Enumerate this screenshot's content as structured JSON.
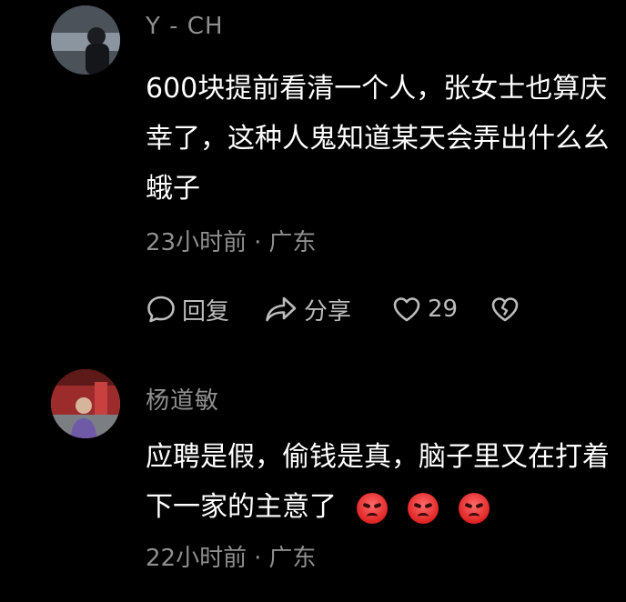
{
  "comments": [
    {
      "username": "Y - CH",
      "text": "600块提前看清一个人，张女士也算庆幸了，这种人鬼知道某天会弄出什么幺蛾子",
      "time": "23小时前",
      "location": "广东",
      "actions": {
        "reply_label": "回复",
        "share_label": "分享",
        "like_count": "29"
      }
    },
    {
      "username": "杨道敏",
      "text": "应聘是假，偷钱是真，脑子里又在打着下一家的主意了",
      "emojis": [
        "angry-face-icon",
        "angry-face-icon",
        "angry-face-icon"
      ],
      "time": "22小时前",
      "location": "广东"
    }
  ],
  "separator": "·",
  "colors": {
    "background": "#000000",
    "secondary_text": "#8f8f8f",
    "primary_text": "#ffffff",
    "emoji": "#e02424"
  }
}
